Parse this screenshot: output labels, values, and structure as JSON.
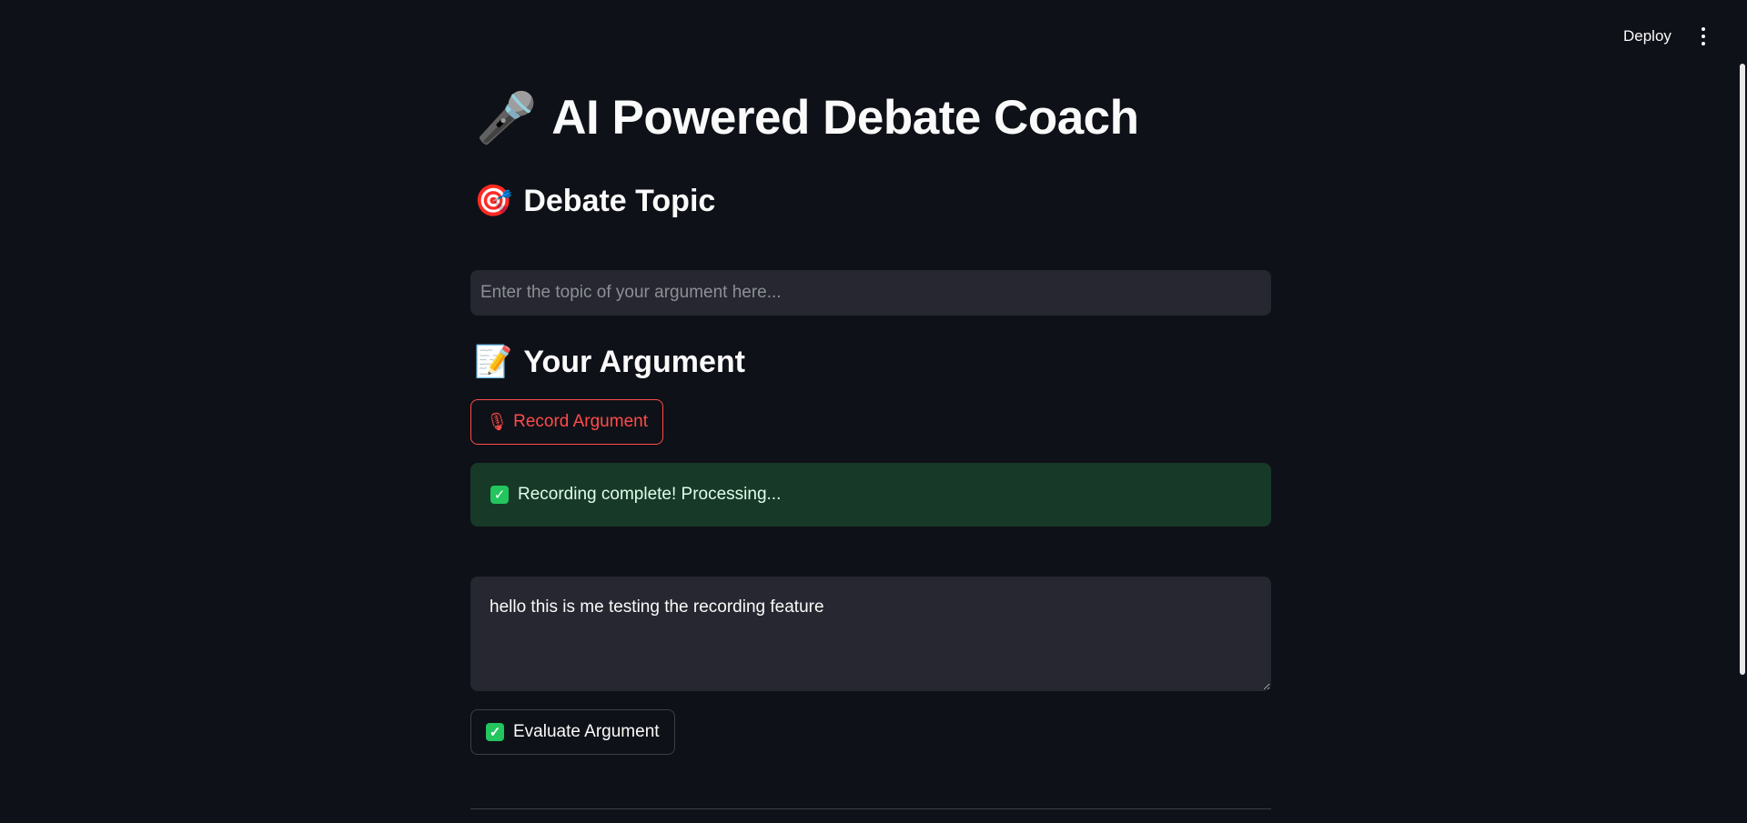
{
  "header": {
    "deploy_label": "Deploy",
    "menu_icon": "vertical-ellipsis-icon"
  },
  "main": {
    "title_emoji": "🎤",
    "title": "AI Powered Debate Coach",
    "topic_section": {
      "emoji": "🎯",
      "heading": "Debate Topic",
      "input_placeholder": "Enter the topic of your argument here...",
      "input_value": ""
    },
    "argument_section": {
      "emoji": "📝",
      "heading": "Your Argument",
      "record_button_icon": "🎙",
      "record_button_label": "Record Argument",
      "success_icon": "✓",
      "success_message": "Recording complete! Processing...",
      "argument_text": "hello this is me testing the recording feature",
      "evaluate_icon": "✓",
      "evaluate_button_label": "Evaluate Argument"
    }
  },
  "colors": {
    "background": "#0e1117",
    "input_bg": "#262730",
    "accent_red": "#ff4b4b",
    "success_bg": "#173928",
    "check_green": "#22c55e"
  }
}
